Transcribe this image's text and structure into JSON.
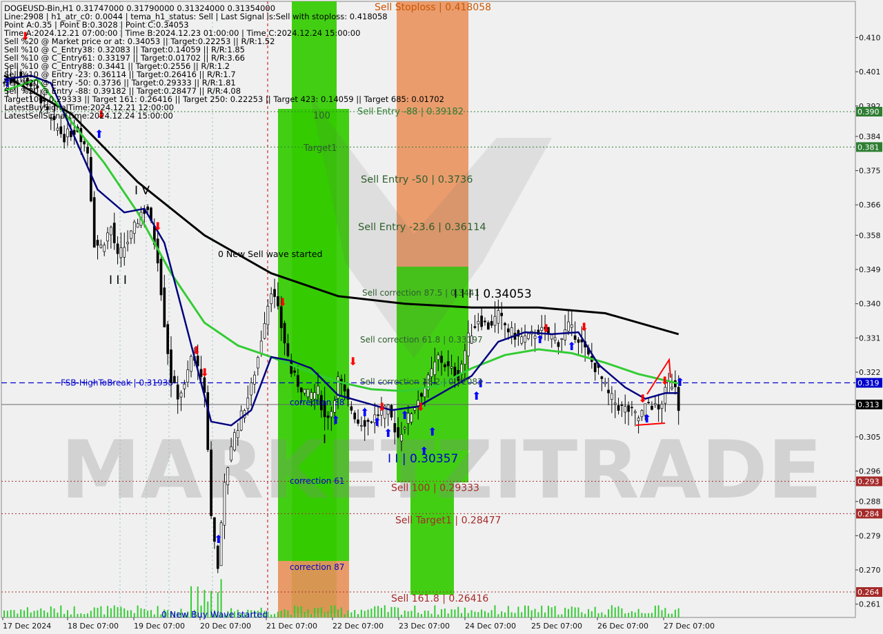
{
  "header": {
    "lines": [
      "DOGEUSD-Bin,H1  0.31747000 0.31790000 0.31324000 0.31354000",
      "Line:2908 | h1_atr_c0: 0.0044 | tema_h1_status: Sell | Last Signal is:Sell with stoploss: 0.418058",
      "Point A:0.35 | Point B:0.3028 | Point C:0.34053",
      "Time A:2024.12.21 07:00:00 | Time B:2024.12.23 01:00:00 | Time C:2024.12.24 15:00:00",
      "Sell %20 @ Market price or at: 0.34053 || Target:0.22253 || R/R:1.52",
      "Sell %10 @ C_Entry38: 0.32083 || Target:0.14059 || R/R:1.85",
      "Sell %10 @ C_Entry61: 0.33197 || Target:0.01702 || R/R:3.66",
      "Sell %10 @ C_Entry88: 0.3441 || Target:0.2556 || R/R:1.2",
      "Sell %10 @ Entry -23: 0.36114 || Target:0.26416 || R/R:1.7",
      "Sell %20 @ Entry -50: 0.3736 || Target:0.29333 || R/R:1.81",
      "Sell %20 @ Entry -88: 0.39182 || Target:0.28477 || R/R:4.08",
      "Target100: 0.29333 || Target 161: 0.26416 || Target 250: 0.22253 || Target 423: 0.14059 || Target 685: 0.01702",
      "LatestBuySignalTime:2024.12.21 12:00:00",
      "LatestSellSignalTime:2024.12.24 15:00:00"
    ]
  },
  "watermark": "MARKETZITRADE",
  "colors": {
    "background": "#f0f0f0",
    "bull_candle": "#000000",
    "bear_candle": "#000000",
    "ema_slow": "#000000",
    "ema_mid": "#33cc33",
    "ema_fast": "#000080",
    "zone_green": "#33cc00",
    "zone_orange": "#e8905a",
    "level_red": "#a52a2a",
    "level_green": "#2e7d32",
    "fsb_blue": "#0000cc"
  },
  "chart_data": {
    "type": "candlestick",
    "symbol": "DOGEUSD-Bin",
    "timeframe": "H1",
    "ylim": [
      0.2575,
      0.4195
    ],
    "xlabels": [
      "17 Dec 2024",
      "18 Dec 07:00",
      "19 Dec 07:00",
      "20 Dec 07:00",
      "21 Dec 07:00",
      "22 Dec 07:00",
      "23 Dec 07:00",
      "24 Dec 07:00",
      "25 Dec 07:00",
      "26 Dec 07:00",
      "27 Dec 07:00"
    ],
    "yticks": [
      "0.410",
      "0.401",
      "0.392",
      "0.384",
      "0.375",
      "0.366",
      "0.358",
      "0.349",
      "0.340",
      "0.331",
      "0.322",
      "0.313",
      "0.305",
      "0.296",
      "0.288",
      "0.279",
      "0.270",
      "0.261"
    ],
    "price_tags": [
      {
        "label": "0.390",
        "value": 0.3905,
        "color": "#2e7d32"
      },
      {
        "label": "0.381",
        "value": 0.3812,
        "color": "#2e7d32"
      },
      {
        "label": "0.319",
        "value": 0.3192,
        "color": "#0000cc"
      },
      {
        "label": "0.313",
        "value": 0.3135,
        "color": "#000000"
      },
      {
        "label": "0.293",
        "value": 0.2933,
        "color": "#a52a2a"
      },
      {
        "label": "0.284",
        "value": 0.2848,
        "color": "#a52a2a"
      },
      {
        "label": "0.264",
        "value": 0.2642,
        "color": "#a52a2a"
      }
    ],
    "levels": [
      {
        "label": "Sell Entry -88 | 0.39182",
        "value": 0.3905,
        "color": "#2e7d32",
        "style": "dotted"
      },
      {
        "value": 0.3812,
        "color": "#2e7d32",
        "style": "dotted"
      },
      {
        "label": "FSB-HighToBreak | 0.31938",
        "value": 0.3192,
        "color": "#0000cc",
        "style": "dashed"
      },
      {
        "value": 0.3135,
        "color": "#666666",
        "style": "solid"
      },
      {
        "label": "Sell 100 | 0.29333",
        "value": 0.2933,
        "color": "#a52a2a",
        "style": "dotted"
      },
      {
        "label": "Sell Target1 | 0.28477",
        "value": 0.2848,
        "color": "#a52a2a",
        "style": "dotted"
      },
      {
        "label": "Sell 161.8 | 0.26416",
        "value": 0.2642,
        "color": "#a52a2a",
        "style": "dotted"
      }
    ],
    "annotations": [
      {
        "text": "Sell Stoploss | 0.418058",
        "color": "#cc5500"
      },
      {
        "text": "Sell Entry -50 | 0.3736",
        "color": "#2e5e2e"
      },
      {
        "text": "Sell Entry -23.6 | 0.36114",
        "color": "#2e5e2e"
      },
      {
        "text": "Sell correction 87.5 | 0.3441",
        "color": "#2e5e2e"
      },
      {
        "text": "Sell correction 61.8 | 0.33197",
        "color": "#2e5e2e"
      },
      {
        "text": "Sell correction 38.2 | 0.32083",
        "color": "#2e5e2e"
      },
      {
        "text": "I I I | 0.34053",
        "color": "#000000"
      },
      {
        "text": "I I | 0.30357",
        "color": "#0000cc"
      },
      {
        "text": "0 New Sell wave started",
        "color": "#000000"
      },
      {
        "text": "0 New Buy Wave started",
        "color": "#0000cc"
      },
      {
        "text": "100",
        "color": "#2e5e2e"
      },
      {
        "text": "Target1",
        "color": "#2e5e2e"
      },
      {
        "text": "correction 38",
        "color": "#0000cc"
      },
      {
        "text": "correction 61",
        "color": "#0000cc"
      },
      {
        "text": "correction 87",
        "color": "#0000cc"
      },
      {
        "text": "I V",
        "color": "#000000"
      },
      {
        "text": "I I I",
        "color": "#000000"
      },
      {
        "text": "I",
        "color": "#000000"
      }
    ],
    "candle_anchors": [
      [
        0,
        0.398
      ],
      [
        5,
        0.4
      ],
      [
        10,
        0.396
      ],
      [
        14,
        0.388
      ],
      [
        18,
        0.384
      ],
      [
        22,
        0.386
      ],
      [
        25,
        0.38
      ],
      [
        27,
        0.356
      ],
      [
        29,
        0.355
      ],
      [
        32,
        0.36
      ],
      [
        34,
        0.352
      ],
      [
        38,
        0.358
      ],
      [
        41,
        0.364
      ],
      [
        43,
        0.365
      ],
      [
        46,
        0.352
      ],
      [
        48,
        0.335
      ],
      [
        50,
        0.32
      ],
      [
        52,
        0.316
      ],
      [
        54,
        0.318
      ],
      [
        56,
        0.326
      ],
      [
        58,
        0.324
      ],
      [
        60,
        0.318
      ],
      [
        62,
        0.285
      ],
      [
        64,
        0.27
      ],
      [
        66,
        0.292
      ],
      [
        68,
        0.303
      ],
      [
        70,
        0.308
      ],
      [
        72,
        0.313
      ],
      [
        74,
        0.318
      ],
      [
        76,
        0.326
      ],
      [
        78,
        0.336
      ],
      [
        80,
        0.344
      ],
      [
        82,
        0.338
      ],
      [
        84,
        0.33
      ],
      [
        86,
        0.322
      ],
      [
        88,
        0.319
      ],
      [
        91,
        0.316
      ],
      [
        94,
        0.317
      ],
      [
        96,
        0.31
      ],
      [
        98,
        0.312
      ],
      [
        100,
        0.32
      ],
      [
        103,
        0.314
      ],
      [
        106,
        0.309
      ],
      [
        109,
        0.309
      ],
      [
        112,
        0.311
      ],
      [
        115,
        0.312
      ],
      [
        118,
        0.305
      ],
      [
        121,
        0.31
      ],
      [
        124,
        0.315
      ],
      [
        127,
        0.32
      ],
      [
        130,
        0.326
      ],
      [
        133,
        0.323
      ],
      [
        136,
        0.321
      ],
      [
        139,
        0.331
      ],
      [
        142,
        0.336
      ],
      [
        145,
        0.334
      ],
      [
        148,
        0.337
      ],
      [
        151,
        0.333
      ],
      [
        154,
        0.331
      ],
      [
        157,
        0.331
      ],
      [
        160,
        0.333
      ],
      [
        163,
        0.332
      ],
      [
        166,
        0.33
      ],
      [
        169,
        0.334
      ],
      [
        172,
        0.331
      ],
      [
        175,
        0.326
      ],
      [
        178,
        0.322
      ],
      [
        181,
        0.316
      ],
      [
        184,
        0.313
      ],
      [
        187,
        0.312
      ],
      [
        190,
        0.31
      ],
      [
        193,
        0.314
      ],
      [
        196,
        0.312
      ],
      [
        199,
        0.319
      ],
      [
        201,
        0.319
      ],
      [
        202,
        0.313
      ]
    ],
    "ema_slow": [
      [
        0,
        0.4
      ],
      [
        20,
        0.39
      ],
      [
        40,
        0.372
      ],
      [
        60,
        0.358
      ],
      [
        80,
        0.348
      ],
      [
        100,
        0.342
      ],
      [
        120,
        0.34
      ],
      [
        140,
        0.339
      ],
      [
        160,
        0.339
      ],
      [
        180,
        0.3375
      ],
      [
        202,
        0.332
      ]
    ],
    "ema_mid": [
      [
        0,
        0.396
      ],
      [
        10,
        0.399
      ],
      [
        20,
        0.388
      ],
      [
        30,
        0.377
      ],
      [
        40,
        0.364
      ],
      [
        50,
        0.348
      ],
      [
        60,
        0.335
      ],
      [
        70,
        0.329
      ],
      [
        80,
        0.326
      ],
      [
        90,
        0.3225
      ],
      [
        100,
        0.3195
      ],
      [
        110,
        0.3175
      ],
      [
        120,
        0.317
      ],
      [
        130,
        0.3185
      ],
      [
        140,
        0.323
      ],
      [
        150,
        0.3265
      ],
      [
        160,
        0.328
      ],
      [
        170,
        0.327
      ],
      [
        180,
        0.3245
      ],
      [
        190,
        0.3215
      ],
      [
        202,
        0.319
      ]
    ],
    "ema_fast": [
      [
        0,
        0.399
      ],
      [
        8,
        0.4
      ],
      [
        14,
        0.398
      ],
      [
        20,
        0.386
      ],
      [
        28,
        0.37
      ],
      [
        36,
        0.364
      ],
      [
        42,
        0.365
      ],
      [
        48,
        0.356
      ],
      [
        54,
        0.336
      ],
      [
        62,
        0.309
      ],
      [
        68,
        0.308
      ],
      [
        74,
        0.312
      ],
      [
        80,
        0.326
      ],
      [
        86,
        0.325
      ],
      [
        92,
        0.323
      ],
      [
        100,
        0.316
      ],
      [
        108,
        0.314
      ],
      [
        116,
        0.312
      ],
      [
        124,
        0.313
      ],
      [
        132,
        0.317
      ],
      [
        140,
        0.321
      ],
      [
        148,
        0.33
      ],
      [
        156,
        0.3325
      ],
      [
        164,
        0.332
      ],
      [
        172,
        0.3325
      ],
      [
        178,
        0.324
      ],
      [
        186,
        0.318
      ],
      [
        192,
        0.315
      ],
      [
        198,
        0.3165
      ],
      [
        202,
        0.3165
      ]
    ]
  }
}
